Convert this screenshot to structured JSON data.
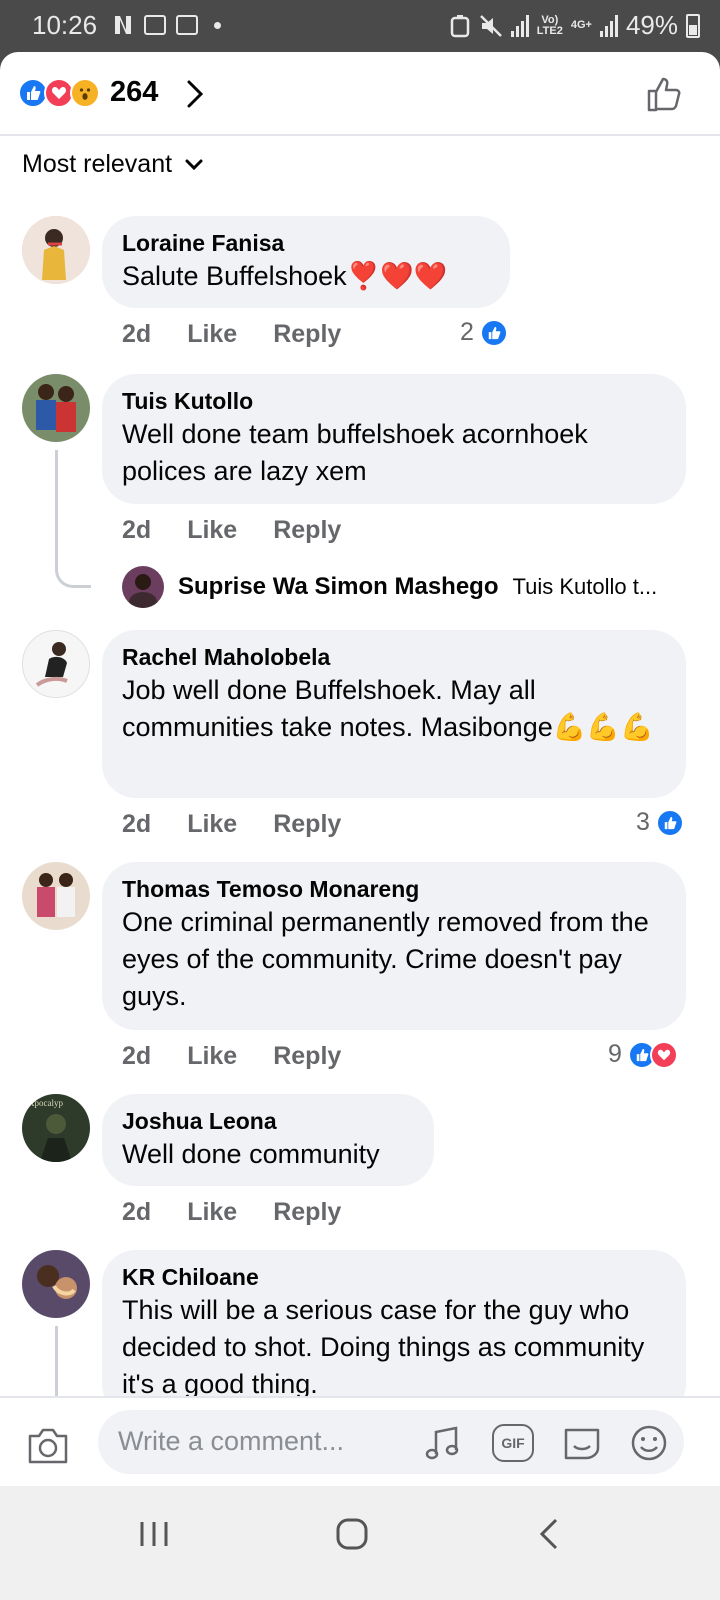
{
  "status_bar": {
    "time": "10:26",
    "battery": "49%",
    "net_top": "Vo)",
    "net_bottom": "LTE2",
    "net4g": "4G+"
  },
  "reactions": {
    "count": "264",
    "icons": [
      "like-icon",
      "love-icon",
      "wow-icon"
    ]
  },
  "sort": {
    "label": "Most relevant"
  },
  "comments": [
    {
      "name": "Loraine Fanisa",
      "text": "Salute Buffelshoek❣️❤️❤️",
      "time": "2d",
      "like": "Like",
      "reply": "Reply",
      "reactions": "2"
    },
    {
      "name": "Tuis Kutollo",
      "text": "Well done team buffelshoek acornhoek polices are lazy xem",
      "time": "2d",
      "like": "Like",
      "reply": "Reply"
    },
    {
      "name": "Rachel Maholobela",
      "text": "Job well done Buffelshoek.  May all communities take notes. Masibonge💪💪💪",
      "time": "2d",
      "like": "Like",
      "reply": "Reply",
      "reactions": "3"
    },
    {
      "name": "Thomas Temoso Monareng",
      "text": "One criminal permanently removed from the eyes of the community. Crime doesn't pay guys.",
      "time": "2d",
      "like": "Like",
      "reply": "Reply",
      "reactions": "9"
    },
    {
      "name": "Joshua Leona",
      "text": "Well done community",
      "time": "2d",
      "like": "Like",
      "reply": "Reply",
      "avatar_text": "Apocalyp"
    },
    {
      "name": "KR Chiloane",
      "text": "This will be a serious case for the guy who decided to shot. Doing things as community it's a good thing."
    }
  ],
  "reply_preview": {
    "name": "Suprise Wa Simon Mashego",
    "snippet": "Tuis Kutollo t..."
  },
  "composer": {
    "placeholder": "Write a comment...",
    "gif": "GIF"
  },
  "colors": {
    "accent": "#1877f2",
    "love": "#f33e58",
    "bubble": "#f0f2f5",
    "secondary_text": "#65676b"
  }
}
